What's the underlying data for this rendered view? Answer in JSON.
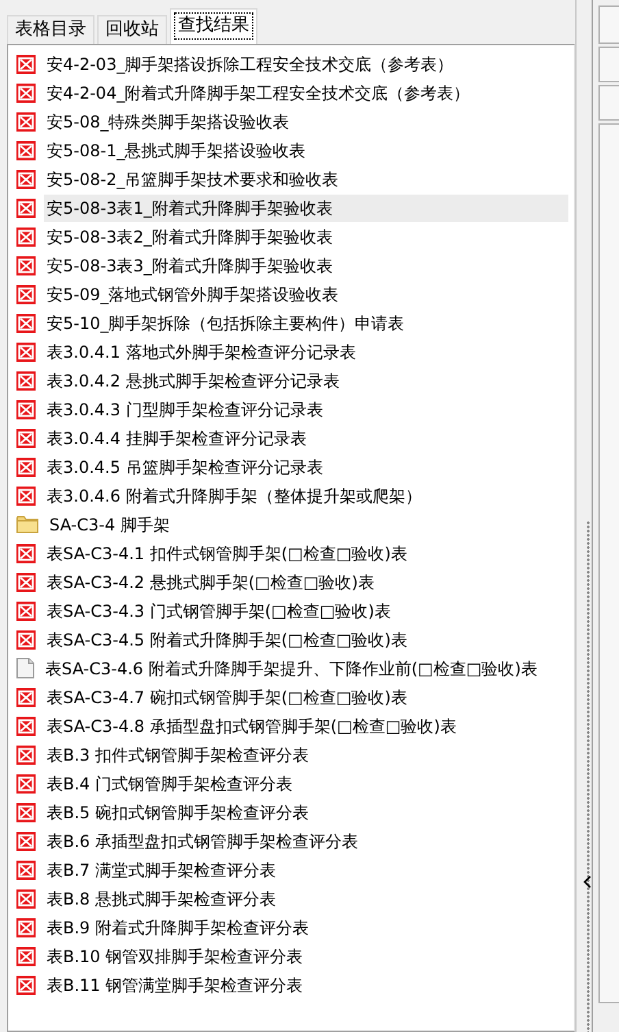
{
  "tabs": [
    {
      "label": "表格目录",
      "selected": false
    },
    {
      "label": "回收站",
      "selected": false
    },
    {
      "label": "查找结果",
      "selected": true
    }
  ],
  "results": [
    {
      "kind": "pdf",
      "label": "安4-2-03_脚手架搭设拆除工程安全技术交底（参考表）",
      "selected": false
    },
    {
      "kind": "pdf",
      "label": "安4-2-04_附着式升降脚手架工程安全技术交底（参考表）",
      "selected": false
    },
    {
      "kind": "pdf",
      "label": "安5-08_特殊类脚手架搭设验收表",
      "selected": false
    },
    {
      "kind": "pdf",
      "label": "安5-08-1_悬挑式脚手架搭设验收表",
      "selected": false
    },
    {
      "kind": "pdf",
      "label": "安5-08-2_吊篮脚手架技术要求和验收表",
      "selected": false
    },
    {
      "kind": "pdf",
      "label": "安5-08-3表1_附着式升降脚手架验收表",
      "selected": true
    },
    {
      "kind": "pdf",
      "label": "安5-08-3表2_附着式升降脚手架验收表",
      "selected": false
    },
    {
      "kind": "pdf",
      "label": "安5-08-3表3_附着式升降脚手架验收表",
      "selected": false
    },
    {
      "kind": "pdf",
      "label": "安5-09_落地式钢管外脚手架搭设验收表",
      "selected": false
    },
    {
      "kind": "pdf",
      "label": "安5-10_脚手架拆除（包括拆除主要构件）申请表",
      "selected": false
    },
    {
      "kind": "pdf",
      "label": "表3.0.4.1 落地式外脚手架检查评分记录表",
      "selected": false
    },
    {
      "kind": "pdf",
      "label": "表3.0.4.2 悬挑式脚手架检查评分记录表",
      "selected": false
    },
    {
      "kind": "pdf",
      "label": "表3.0.4.3 门型脚手架检查评分记录表",
      "selected": false
    },
    {
      "kind": "pdf",
      "label": "表3.0.4.4 挂脚手架检查评分记录表",
      "selected": false
    },
    {
      "kind": "pdf",
      "label": "表3.0.4.5 吊篮脚手架检查评分记录表",
      "selected": false
    },
    {
      "kind": "pdf",
      "label": "表3.0.4.6 附着式升降脚手架（整体提升架或爬架）",
      "selected": false
    },
    {
      "kind": "folder",
      "label": "SA-C3-4 脚手架",
      "selected": false
    },
    {
      "kind": "pdf",
      "label": "表SA-C3-4.1 扣件式钢管脚手架(□检查□验收)表",
      "selected": false
    },
    {
      "kind": "pdf",
      "label": "表SA-C3-4.2 悬挑式脚手架(□检查□验收)表",
      "selected": false
    },
    {
      "kind": "pdf",
      "label": "表SA-C3-4.3 门式钢管脚手架(□检查□验收)表",
      "selected": false
    },
    {
      "kind": "pdf",
      "label": "表SA-C3-4.5 附着式升降脚手架(□检查□验收)表",
      "selected": false
    },
    {
      "kind": "doc",
      "label": "表SA-C3-4.6 附着式升降脚手架提升、下降作业前(□检查□验收)表",
      "selected": false
    },
    {
      "kind": "pdf",
      "label": "表SA-C3-4.7 碗扣式钢管脚手架(□检查□验收)表",
      "selected": false
    },
    {
      "kind": "pdf",
      "label": "表SA-C3-4.8 承插型盘扣式钢管脚手架(□检查□验收)表",
      "selected": false
    },
    {
      "kind": "pdf",
      "label": "表B.3 扣件式钢管脚手架检查评分表",
      "selected": false
    },
    {
      "kind": "pdf",
      "label": "表B.4 门式钢管脚手架检查评分表",
      "selected": false
    },
    {
      "kind": "pdf",
      "label": "表B.5 碗扣式钢管脚手架检查评分表",
      "selected": false
    },
    {
      "kind": "pdf",
      "label": "表B.6 承插型盘扣式钢管脚手架检查评分表",
      "selected": false
    },
    {
      "kind": "pdf",
      "label": "表B.7 满堂式脚手架检查评分表",
      "selected": false
    },
    {
      "kind": "pdf",
      "label": "表B.8 悬挑式脚手架检查评分表",
      "selected": false
    },
    {
      "kind": "pdf",
      "label": "表B.9 附着式升降脚手架检查评分表",
      "selected": false
    },
    {
      "kind": "pdf",
      "label": "表B.10 钢管双排脚手架检查评分表",
      "selected": false
    },
    {
      "kind": "pdf",
      "label": "表B.11 钢管满堂脚手架检查评分表",
      "selected": false
    }
  ]
}
